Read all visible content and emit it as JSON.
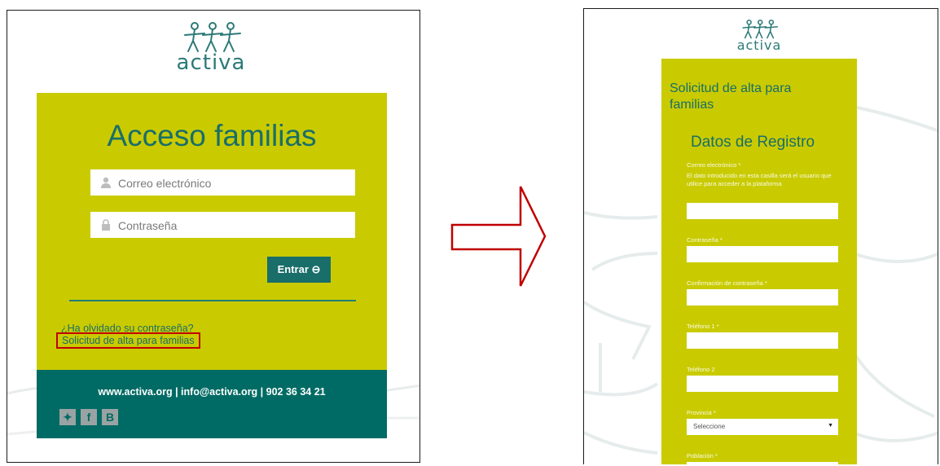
{
  "left": {
    "logo_word": "activa",
    "title": "Acceso familias",
    "email_placeholder": "Correo electrónico",
    "password_placeholder": "Contraseña",
    "login_button": "Entrar ⊖",
    "forgot_link": "¿Ha olvidado su contraseña?",
    "signup_link": "Solicitud de alta para familias",
    "footer_contact": "www.activa.org | info@activa.org | 902 36 34 21",
    "social": [
      {
        "name": "twitter-icon",
        "glyph": "🐦"
      },
      {
        "name": "facebook-icon",
        "glyph": "f"
      },
      {
        "name": "blogger-icon",
        "glyph": "B"
      }
    ],
    "colors": {
      "card": "#c9cb00",
      "teal": "#196e69",
      "footer": "#006b64",
      "highlight": "#c00000"
    }
  },
  "arrow": {
    "color": "#c00000"
  },
  "right": {
    "logo_word": "activa",
    "title": "Solicitud de alta para familias",
    "section_title": "Datos de Registro",
    "fields": [
      {
        "label": "Correo electrónico *",
        "help": "El dato introducido en esta casilla será el usuario que utilice para acceder a la plataforma"
      },
      {
        "label": "Contraseña *"
      },
      {
        "label": "Confirmación de contraseña *"
      },
      {
        "label": "Teléfono 1 *"
      },
      {
        "label": "Teléfono 2"
      },
      {
        "label": "Provincia *",
        "select": "Seleccione"
      },
      {
        "label": "Población *"
      }
    ]
  }
}
